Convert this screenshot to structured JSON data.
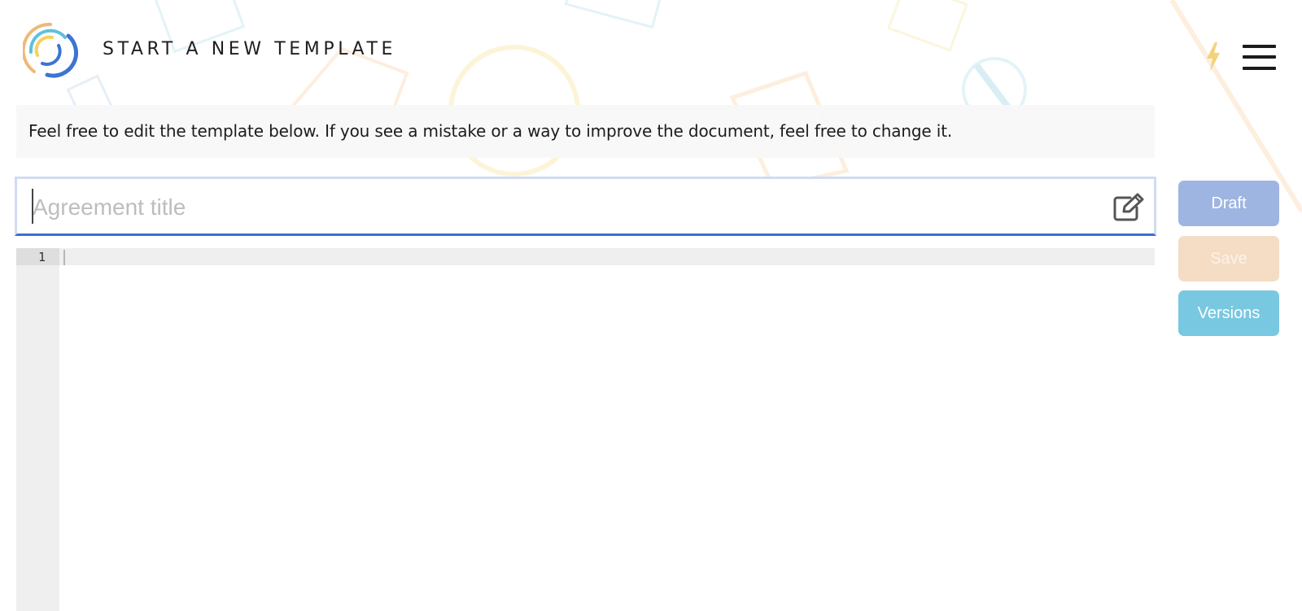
{
  "header": {
    "title": "START A NEW TEMPLATE",
    "logo_icon": "ring-logo-icon",
    "bolt_icon": "lightning-icon",
    "menu_icon": "hamburger-menu-icon"
  },
  "notice": {
    "text": "Feel free to edit the template below. If you see a mistake or a way to improve the document, feel free to change it."
  },
  "title_field": {
    "placeholder": "Agreement title",
    "value": "",
    "icon": "edit-icon"
  },
  "editor": {
    "line_numbers": [
      "1"
    ],
    "content": ""
  },
  "actions": {
    "draft_label": "Draft",
    "save_label": "Save",
    "versions_label": "Versions"
  },
  "colors": {
    "draft": "#9fb5e1",
    "save": "#f5dcc4",
    "versions": "#79c8e1",
    "focus_underline": "#3b6fd6",
    "logo_blue": "#3c74d3",
    "logo_yellow": "#f4d25a",
    "logo_orange": "#f0b878",
    "logo_cyan": "#5ec0dc"
  }
}
